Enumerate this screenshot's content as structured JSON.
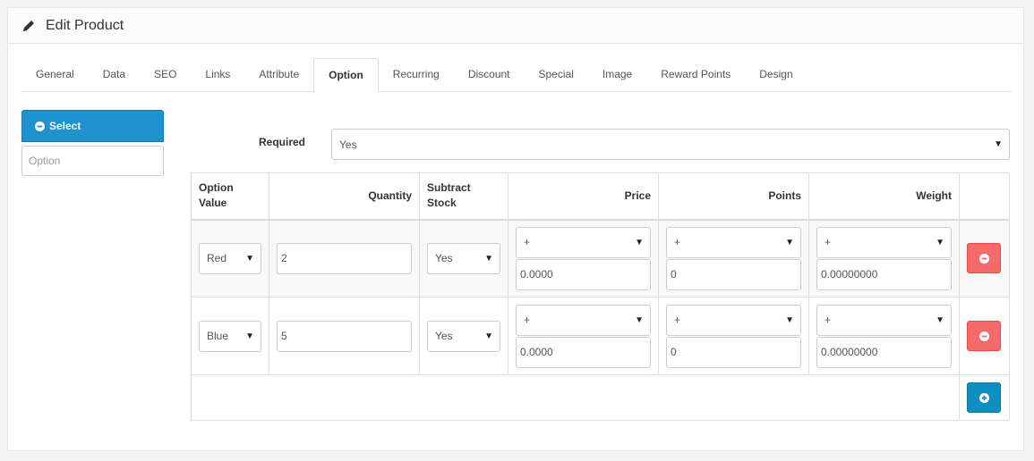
{
  "header": {
    "title": "Edit Product",
    "icon": "pencil-icon"
  },
  "tabs": [
    {
      "label": "General",
      "active": false
    },
    {
      "label": "Data",
      "active": false
    },
    {
      "label": "SEO",
      "active": false
    },
    {
      "label": "Links",
      "active": false
    },
    {
      "label": "Attribute",
      "active": false
    },
    {
      "label": "Option",
      "active": true
    },
    {
      "label": "Recurring",
      "active": false
    },
    {
      "label": "Discount",
      "active": false
    },
    {
      "label": "Special",
      "active": false
    },
    {
      "label": "Image",
      "active": false
    },
    {
      "label": "Reward Points",
      "active": false
    },
    {
      "label": "Design",
      "active": false
    }
  ],
  "sidebar": {
    "select_button": "Select",
    "option_placeholder": "Option"
  },
  "required": {
    "label": "Required",
    "value": "Yes"
  },
  "table": {
    "headers": [
      "Option Value",
      "Quantity",
      "Subtract Stock",
      "Price",
      "Points",
      "Weight"
    ],
    "rows": [
      {
        "option_value": "Red",
        "quantity": "2",
        "subtract": "Yes",
        "price_prefix": "+",
        "price": "0.0000",
        "points_prefix": "+",
        "points": "0",
        "weight_prefix": "+",
        "weight": "0.00000000"
      },
      {
        "option_value": "Blue",
        "quantity": "5",
        "subtract": "Yes",
        "price_prefix": "+",
        "price": "0.0000",
        "points_prefix": "+",
        "points": "0",
        "weight_prefix": "+",
        "weight": "0.00000000"
      }
    ]
  },
  "colors": {
    "primary": "#1e91cf",
    "danger": "#f56b6b",
    "add": "#0e8fc1"
  }
}
